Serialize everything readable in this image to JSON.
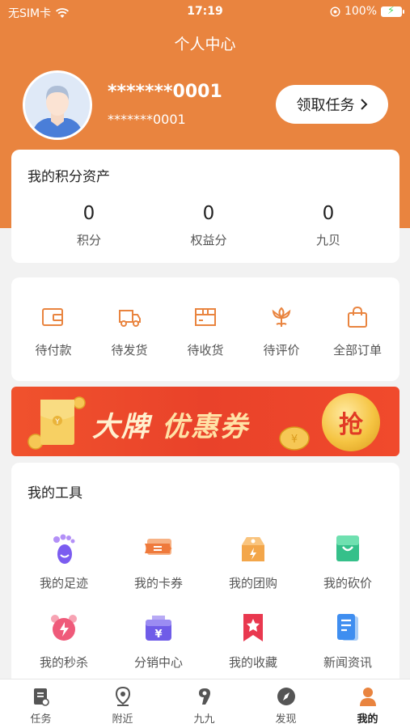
{
  "status": {
    "carrier": "无SIM卡",
    "time": "17:19",
    "battery": "100%"
  },
  "header": {
    "title": "个人中心",
    "username": "*******0001",
    "userid": "*******0001",
    "task_button": "领取任务"
  },
  "assets": {
    "title": "我的积分资产",
    "items": [
      {
        "value": "0",
        "label": "积分"
      },
      {
        "value": "0",
        "label": "权益分"
      },
      {
        "value": "0",
        "label": "九贝"
      }
    ]
  },
  "orders": {
    "items": [
      {
        "label": "待付款",
        "icon": "wallet-icon"
      },
      {
        "label": "待发货",
        "icon": "truck-icon"
      },
      {
        "label": "待收货",
        "icon": "package-icon"
      },
      {
        "label": "待评价",
        "icon": "flower-icon"
      },
      {
        "label": "全部订单",
        "icon": "shopping-bag-icon"
      }
    ]
  },
  "banner": {
    "title_a": "大牌",
    "title_b": "优惠券",
    "action": "抢"
  },
  "tools": {
    "title": "我的工具",
    "items": [
      {
        "label": "我的足迹",
        "icon": "footprint-icon"
      },
      {
        "label": "我的卡券",
        "icon": "coupon-icon"
      },
      {
        "label": "我的团购",
        "icon": "group-buy-icon"
      },
      {
        "label": "我的砍价",
        "icon": "bargain-bag-icon"
      },
      {
        "label": "我的秒杀",
        "icon": "alarm-clock-icon"
      },
      {
        "label": "分销中心",
        "icon": "distribution-icon"
      },
      {
        "label": "我的收藏",
        "icon": "bookmark-icon"
      },
      {
        "label": "新闻资讯",
        "icon": "news-icon"
      }
    ]
  },
  "tabbar": {
    "items": [
      {
        "label": "任务",
        "icon": "task-icon"
      },
      {
        "label": "附近",
        "icon": "location-icon"
      },
      {
        "label": "九九",
        "icon": "nine-icon"
      },
      {
        "label": "发现",
        "icon": "compass-icon"
      },
      {
        "label": "我的",
        "icon": "person-icon"
      }
    ],
    "active_index": 4
  },
  "colors": {
    "brand": "#e9843f",
    "order_icon": "#e9843f",
    "banner_red": "#ee4a2b"
  }
}
